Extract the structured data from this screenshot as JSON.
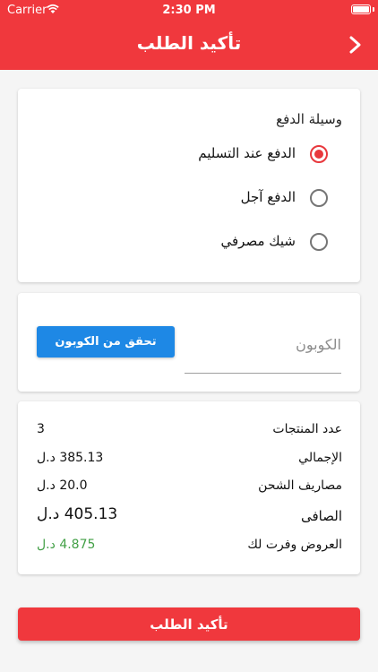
{
  "status_bar": {
    "carrier": "Carrier",
    "time": "2:30 PM"
  },
  "header": {
    "title": "تأكيد الطلب",
    "back_icon": "chevron-right-icon"
  },
  "payment": {
    "title": "وسيلة الدفع",
    "options": [
      {
        "label": "الدفع عند التسليم",
        "selected": true
      },
      {
        "label": "الدفع آجل",
        "selected": false
      },
      {
        "label": "شيك مصرفي",
        "selected": false
      }
    ]
  },
  "coupon": {
    "placeholder": "الكوبون",
    "value": "",
    "button_label": "تحقق من الكوبون"
  },
  "summary": {
    "rows": [
      {
        "label": "عدد المنتجات",
        "value": "3"
      },
      {
        "label": "الإجمالي",
        "value": "385.13 د.ل"
      },
      {
        "label": "مصاريف الشحن",
        "value": "20.0 د.ل"
      },
      {
        "label": "الصافى",
        "value": "405.13 د.ل"
      },
      {
        "label": "العروض وفرت لك",
        "value": "4.875 د.ل"
      }
    ]
  },
  "confirm_button": {
    "label": "تأكيد الطلب"
  },
  "colors": {
    "brand": "#f0383d",
    "button_blue": "#1e88e5",
    "discount": "#43a047",
    "background": "#f5f5f5"
  }
}
